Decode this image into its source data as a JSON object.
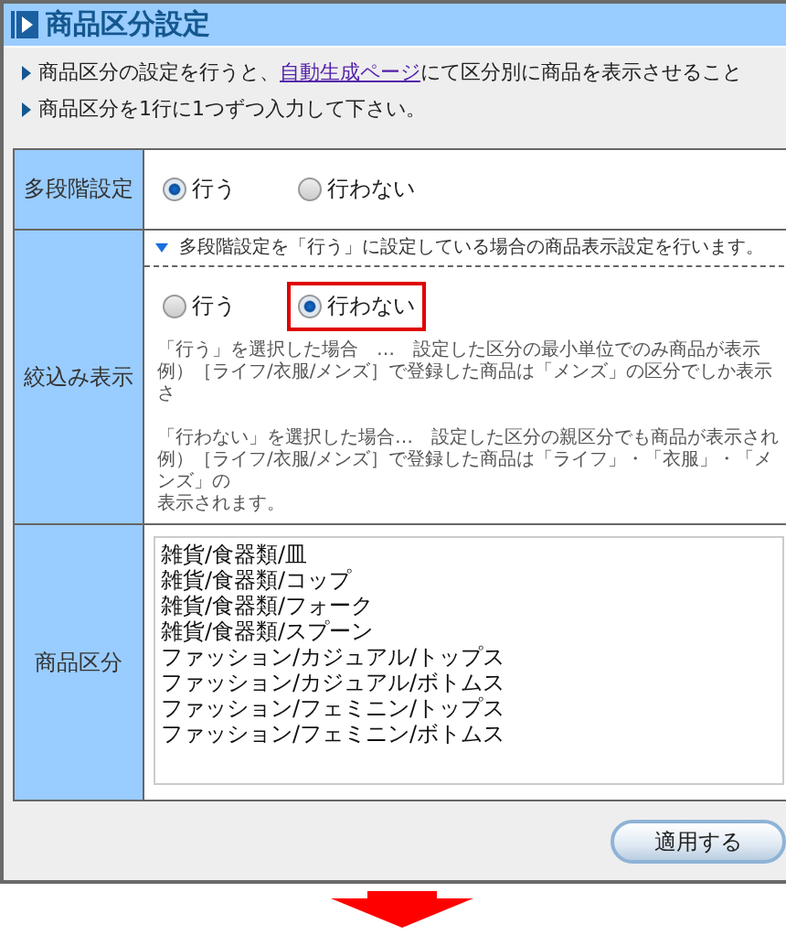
{
  "window": {
    "title": "商品区分設定"
  },
  "notes": [
    {
      "before": "商品区分の設定を行うと、",
      "link": "自動生成ページ",
      "after": "にて区分別に商品を表示させること"
    },
    {
      "before": "商品区分を1行に1つずつ入力して下さい。"
    }
  ],
  "rows": [
    {
      "kind": "radios",
      "label": "多段階設定",
      "options": [
        {
          "label": "行う",
          "selected": true,
          "highlighted": false
        },
        {
          "label": "行わない",
          "selected": false,
          "highlighted": false
        }
      ]
    },
    {
      "kind": "radios",
      "label": "絞込み表示",
      "hint": "多段階設定を「行う」に設定している場合の商品表示設定を行います。",
      "options": [
        {
          "label": "行う",
          "selected": false,
          "highlighted": false
        },
        {
          "label": "行わない",
          "selected": true,
          "highlighted": true
        }
      ],
      "descriptions": [
        [
          "「行う」を選択した場合　…　設定した区分の最小単位でのみ商品が表示",
          "例）［ライフ/衣服/メンズ］で登録した商品は「メンズ」の区分でしか表示さ"
        ],
        [
          "「行わない」を選択した場合…　設定した区分の親区分でも商品が表示され",
          "例）［ライフ/衣服/メンズ］で登録した商品は「ライフ」・「衣服」・「メンズ」の",
          "表示されます。"
        ]
      ]
    },
    {
      "kind": "textarea",
      "label": "商品区分",
      "lines": [
        "雑貨/食器類/皿",
        "雑貨/食器類/コップ",
        "雑貨/食器類/フォーク",
        "雑貨/食器類/スプーン",
        "ファッション/カジュアル/トップス",
        "ファッション/カジュアル/ボトムス",
        "ファッション/フェミニン/トップス",
        "ファッション/フェミニン/ボトムス"
      ]
    }
  ],
  "button": "適用する"
}
